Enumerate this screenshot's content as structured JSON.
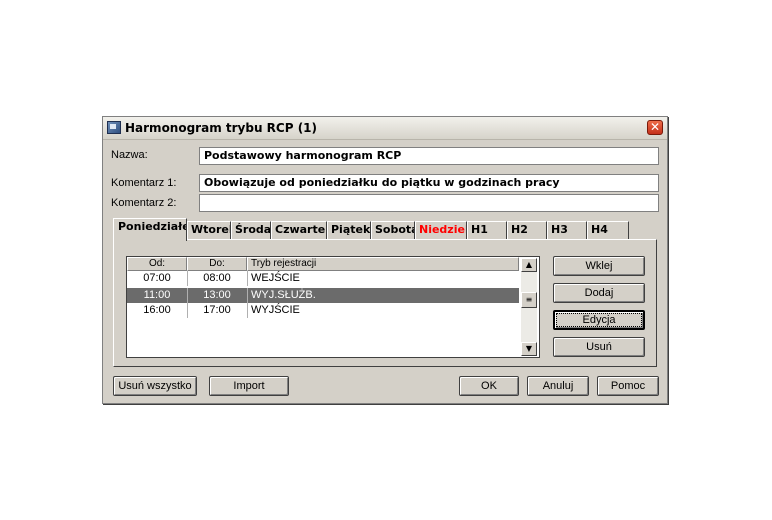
{
  "window": {
    "title": "Harmonogram trybu RCP (1)",
    "close_glyph": "✕"
  },
  "form": {
    "name_label": "Nazwa:",
    "name_value": "Podstawowy harmonogram RCP",
    "comment1_label": "Komentarz 1:",
    "comment1_value": "Obowiązuje od poniedziałku do piątku w godzinach pracy",
    "comment2_label": "Komentarz 2:",
    "comment2_value": ""
  },
  "tabs": [
    {
      "label": "Poniedziałek",
      "active": true
    },
    {
      "label": "Wtorek"
    },
    {
      "label": "Środa"
    },
    {
      "label": "Czwartek"
    },
    {
      "label": "Piątek"
    },
    {
      "label": "Sobota"
    },
    {
      "label": "Niedziela",
      "color": "#ff0000"
    },
    {
      "label": "H1"
    },
    {
      "label": "H2"
    },
    {
      "label": "H3"
    },
    {
      "label": "H4"
    }
  ],
  "list": {
    "columns": [
      "Od:",
      "Do:",
      "Tryb rejestracji"
    ],
    "rows": [
      {
        "from": "07:00",
        "to": "08:00",
        "mode": "WEJŚCIE",
        "selected": false
      },
      {
        "from": "11:00",
        "to": "13:00",
        "mode": "WYJ.SŁUŻB.",
        "selected": true
      },
      {
        "from": "16:00",
        "to": "17:00",
        "mode": "WYJŚCIE",
        "selected": false
      }
    ]
  },
  "side_buttons": {
    "paste": "Wklej",
    "add": "Dodaj",
    "edit": "Edycja",
    "delete": "Usuń"
  },
  "bottom_buttons": {
    "delete_all": "Usuń wszystko",
    "import": "Import",
    "ok": "OK",
    "cancel": "Anuluj",
    "help": "Pomoc"
  },
  "icons": {
    "app": "schedule-app-icon",
    "close": "close-icon",
    "scroll_up": "scroll-up-icon",
    "scroll_down": "scroll-down-icon",
    "scroll_thumb": "scroll-thumb-grip-icon"
  },
  "colors": {
    "face": "#d4d0c8",
    "selected_row": "#6b6b6b",
    "sunday_tab": "#ff0000",
    "close_button": "#d9452a"
  }
}
